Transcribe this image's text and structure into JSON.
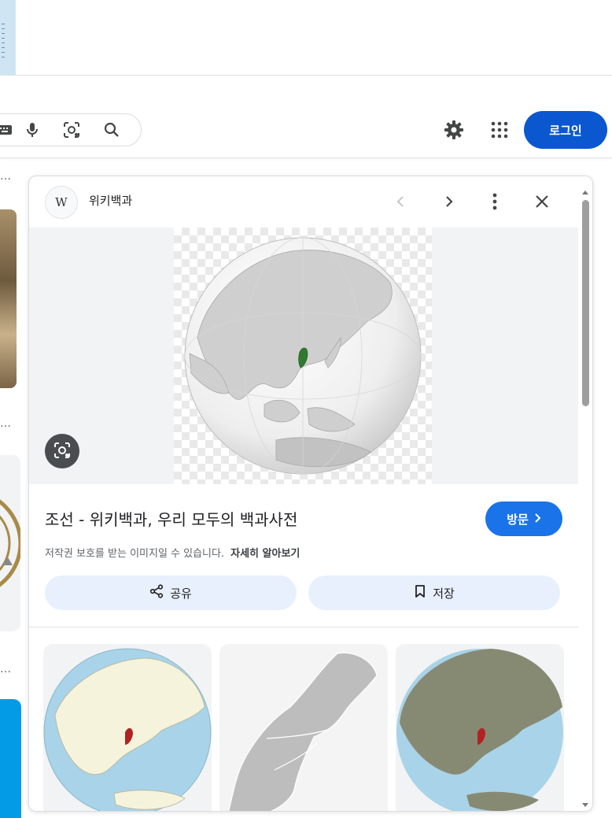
{
  "header": {
    "login_label": "로그인"
  },
  "panel": {
    "source": {
      "favicon_letter": "W",
      "name": "위키백과"
    },
    "result": {
      "title": "조선 - 위키백과, 우리 모두의 백과사전",
      "visit_label": "방문",
      "copyright_note": "저작권 보호를 받는 이미지일 수 있습니다.",
      "learn_more_label": "자세히 알아보기"
    },
    "actions": {
      "share_label": "공유",
      "save_label": "저장"
    }
  },
  "icons": {
    "header": [
      "keyboard-icon",
      "microphone-icon",
      "camera-lens-icon",
      "search-icon",
      "settings-gear-icon",
      "apps-grid-icon"
    ],
    "panel": [
      "chevron-left-icon",
      "chevron-right-icon",
      "more-vert-icon",
      "close-icon",
      "lens-icon",
      "share-icon",
      "bookmark-icon"
    ]
  },
  "colors": {
    "primary_blue": "#0b57d0",
    "visit_blue": "#1a73e8",
    "action_bg": "#e8f0fe",
    "korea_highlight_green": "#2f7a2f",
    "korea_highlight_red": "#b22222",
    "ocean_blue": "#a9d3e8"
  }
}
